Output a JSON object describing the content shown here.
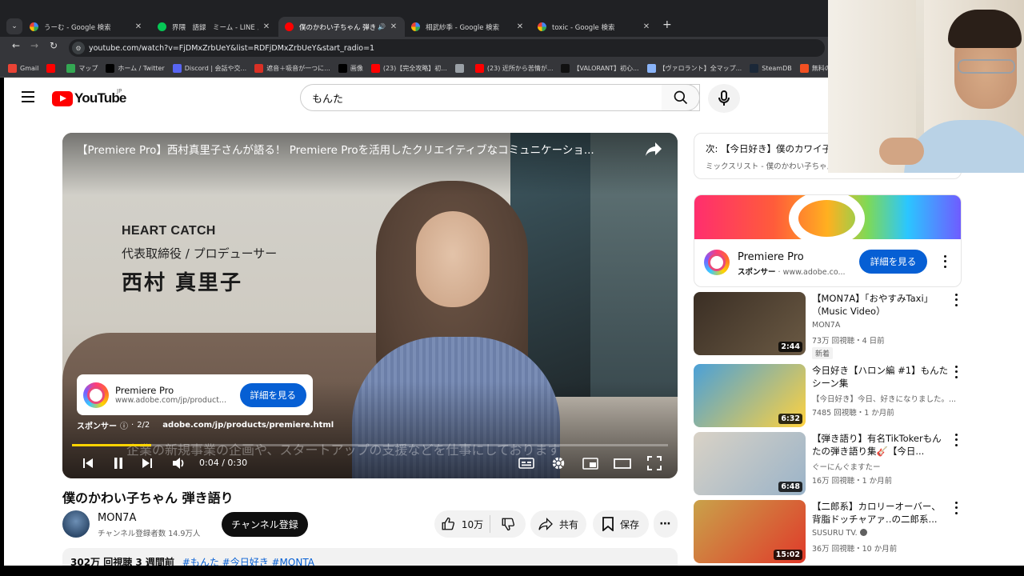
{
  "browser": {
    "tabs": [
      {
        "title": "うーむ - Google 検索",
        "favicon": "google-icon",
        "active": false
      },
      {
        "title": "界隈　語録　ミーム - LINE スタンプ",
        "favicon": "line-icon",
        "active": false
      },
      {
        "title": "僕のかわい子ちゃん 弾き語り",
        "favicon": "youtube-icon",
        "active": true
      },
      {
        "title": "相武紗季 - Google 検索",
        "favicon": "google-icon",
        "active": false
      },
      {
        "title": "toxic - Google 検索",
        "favicon": "google-icon",
        "active": false
      }
    ],
    "url": "youtube.com/watch?v=FjDMxZrbUeY&list=RDFjDMxZrbUeY&start_radio=1",
    "bookmarks": [
      {
        "label": "Gmail",
        "icon": "gmail-icon",
        "color": "#ea4335"
      },
      {
        "label": "",
        "icon": "youtube-icon",
        "color": "#ff0000"
      },
      {
        "label": "マップ",
        "icon": "maps-icon",
        "color": "#34a853"
      },
      {
        "label": "ホーム / Twitter",
        "icon": "x-icon",
        "color": "#000000"
      },
      {
        "label": "Discord | 会話や交...",
        "icon": "discord-icon",
        "color": "#5865f2"
      },
      {
        "label": "遮音＋吸音が一つに...",
        "icon": "bookmark-icon",
        "color": "#d93025"
      },
      {
        "label": "画像",
        "icon": "x-icon",
        "color": "#000000"
      },
      {
        "label": "(23)【完全攻略】初...",
        "icon": "youtube-icon",
        "color": "#ff0000"
      },
      {
        "label": "",
        "icon": "globe-icon",
        "color": "#9aa0a6"
      },
      {
        "label": "(23) 近所から苦情が...",
        "icon": "youtube-icon",
        "color": "#ff0000"
      },
      {
        "label": "【VALORANT】初心...",
        "icon": "valorant-icon",
        "color": "#111111"
      },
      {
        "label": "【ヴァロラント】全マップ...",
        "icon": "globe-icon",
        "color": "#8ab4f8"
      },
      {
        "label": "SteamDB",
        "icon": "steamdb-icon",
        "color": "#1b2838"
      },
      {
        "label": "無料のオンライン スプ...",
        "icon": "microsoft-icon",
        "color": "#f25022"
      }
    ]
  },
  "header": {
    "logo_text": "YouTube",
    "region": "JP",
    "search_value": "もんた"
  },
  "player": {
    "title": "【Premiere Pro】西村真里子さんが語る！ Premiere Proを活用したクリエイティブなコミュニケーショ...",
    "lower_third": {
      "line1": "HEART CATCH",
      "line2": "代表取締役 / プロデューサー",
      "line3": "西村 真里子"
    },
    "ad_card": {
      "name": "Premiere Pro",
      "url": "www.adobe.com/jp/product...",
      "button": "詳細を見る"
    },
    "sponsor_label": "スポンサー",
    "ad_count": "2/2",
    "sponsor_url": "adobe.com/jp/products/premiere.html",
    "subtitle": "企業の新規事業の企画や、スタートアップの支援などを仕事にしております",
    "time": "0:04 / 0:30",
    "progress": 0.133
  },
  "video": {
    "title": "僕のかわい子ちゃん 弾き語り",
    "channel": "MON7A",
    "subscribers": "チャンネル登録者数 14.9万人",
    "subscribe": "チャンネル登録",
    "likes": "10万",
    "share": "共有",
    "save": "保存",
    "views_date": "302万 回視聴  3 週間前",
    "tags": "#もんた #今日好き #MONTA"
  },
  "sidebar": {
    "playlist_next": "次: 【今日好き】僕のカワイ子ちゃん",
    "playlist_sub": "ミックスリスト - 僕のかわい子ちゃん",
    "ad": {
      "name": "Premiere Pro",
      "sponsor": "スポンサー",
      "domain": "www.adobe.co...",
      "button": "詳細を見る"
    },
    "recommendations": [
      {
        "title": "【MON7A】「おやすみTaxi」（Music Video）",
        "channel": "MON7A",
        "meta": "73万 回視聴・4 日前",
        "badge": "新着",
        "duration": "2:44",
        "colors": [
          "#3a2e24",
          "#6b5a44"
        ]
      },
      {
        "title": "今日好き【ハロン編 #1】もんたシーン集",
        "channel": "【今日好き】今日、好きになりました。...",
        "meta": "7485 回視聴・1 か月前",
        "badge": "",
        "duration": "6:32",
        "colors": [
          "#4aa0d8",
          "#ffd23f"
        ]
      },
      {
        "title": "【弾き語り】有名TikTokerもんたの弾き語り集🎸【今日...",
        "channel": "ぐーにんぐますたー",
        "meta": "16万 回視聴・1 か月前",
        "badge": "",
        "duration": "6:48",
        "colors": [
          "#d9d2c6",
          "#9ab3c8"
        ]
      },
      {
        "title": "【二郎系】カロリーオーバー、背脂ドッチャアァ‥の二郎系...",
        "channel": "SUSURU TV.",
        "meta": "36万 回視聴・10 か月前",
        "badge": "",
        "duration": "15:02",
        "colors": [
          "#c9a24a",
          "#e03a2a"
        ]
      }
    ]
  }
}
